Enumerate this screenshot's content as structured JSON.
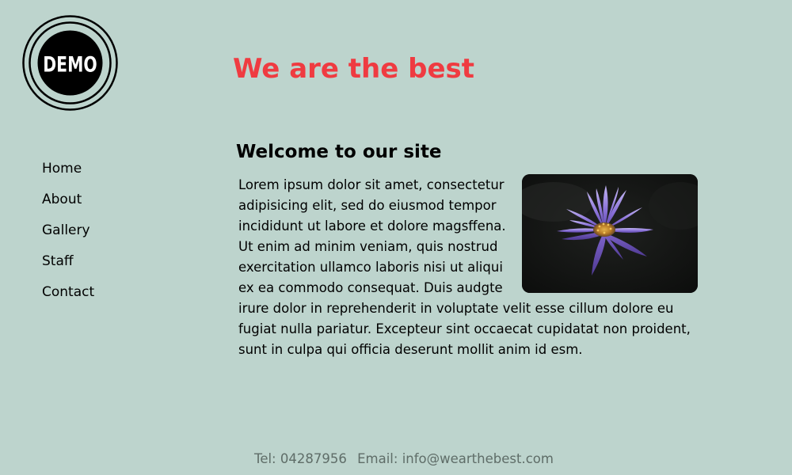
{
  "logo": {
    "text": "DEMO",
    "icon": "demo-logo-icon"
  },
  "header": {
    "title": "We are the best"
  },
  "nav": {
    "items": [
      {
        "label": "Home"
      },
      {
        "label": "About"
      },
      {
        "label": "Gallery"
      },
      {
        "label": "Staff"
      },
      {
        "label": "Contact"
      }
    ]
  },
  "main": {
    "heading": "Welcome to our site",
    "paragraph": "Lorem ipsum dolor sit amet, consectetur adipisicing elit, sed do eiusmod tempor incididunt ut labore et dolore magsffena. Ut enim ad minim veniam, quis nostrud exercitation ullamco laboris nisi ut aliqui ex ea commodo consequat. Duis audgte irure dolor in reprehenderit in voluptate velit esse cillum dolore eu fugiat nulla pariatur. Excepteur sint occaecat cupidatat non proident, sunt in culpa qui officia deserunt mollit anim id esm.",
    "image": {
      "icon": "water-lily-photo"
    }
  },
  "footer": {
    "tel": "Tel: 04287956",
    "email": "Email: info@wearthebest.com"
  },
  "colors": {
    "background": "#bdd4cd",
    "title": "#ef3b41",
    "footer_text": "#5f6d68"
  }
}
